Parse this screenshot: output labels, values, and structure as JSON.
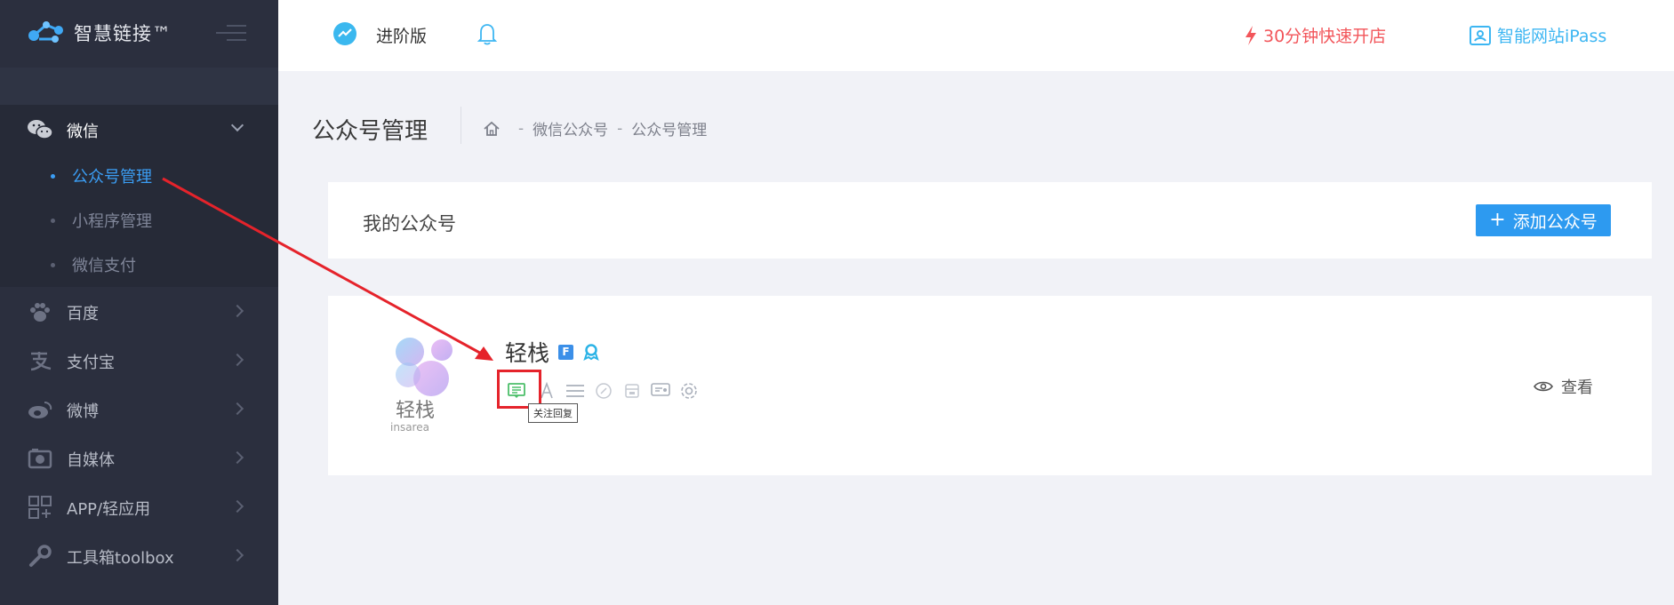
{
  "brand": {
    "name": "智慧链接™"
  },
  "sidebar": {
    "groups": [
      {
        "label": "微信",
        "expanded": true,
        "icon": "wechat-icon",
        "children": [
          {
            "label": "公众号管理",
            "active": true
          },
          {
            "label": "小程序管理",
            "active": false
          },
          {
            "label": "微信支付",
            "active": false
          }
        ]
      },
      {
        "label": "百度",
        "icon": "paw-icon"
      },
      {
        "label": "支付宝",
        "icon": "alipay-icon"
      },
      {
        "label": "微博",
        "icon": "weibo-icon"
      },
      {
        "label": "自媒体",
        "icon": "media-icon"
      },
      {
        "label": "APP/轻应用",
        "icon": "apps-grid-icon"
      },
      {
        "label": "工具箱toolbox",
        "icon": "wrench-icon"
      }
    ]
  },
  "topbar": {
    "edition": "进阶版",
    "promo": "30分钟快速开店",
    "ipass": "智能网站iPass"
  },
  "page": {
    "title": "公众号管理",
    "breadcrumb": [
      "微信公众号",
      "公众号管理"
    ]
  },
  "my_accounts": {
    "title": "我的公众号",
    "add_button": "添加公众号"
  },
  "account": {
    "name": "轻栈",
    "logo_text": "轻栈",
    "logo_sub": "insarea",
    "tooltip": "关注回复",
    "view_label": "查看",
    "tools": [
      "follow-reply-icon",
      "text-icon",
      "menu-lines-icon",
      "link-icon",
      "material-icon",
      "chat-icon",
      "settings-icon"
    ]
  },
  "colors": {
    "sidebar_bg": "#2b2f3e",
    "accent_blue": "#2d9af0",
    "promo_red": "#f2555a",
    "ipass_blue": "#3db6f2",
    "annotation_red": "#e5232b"
  }
}
